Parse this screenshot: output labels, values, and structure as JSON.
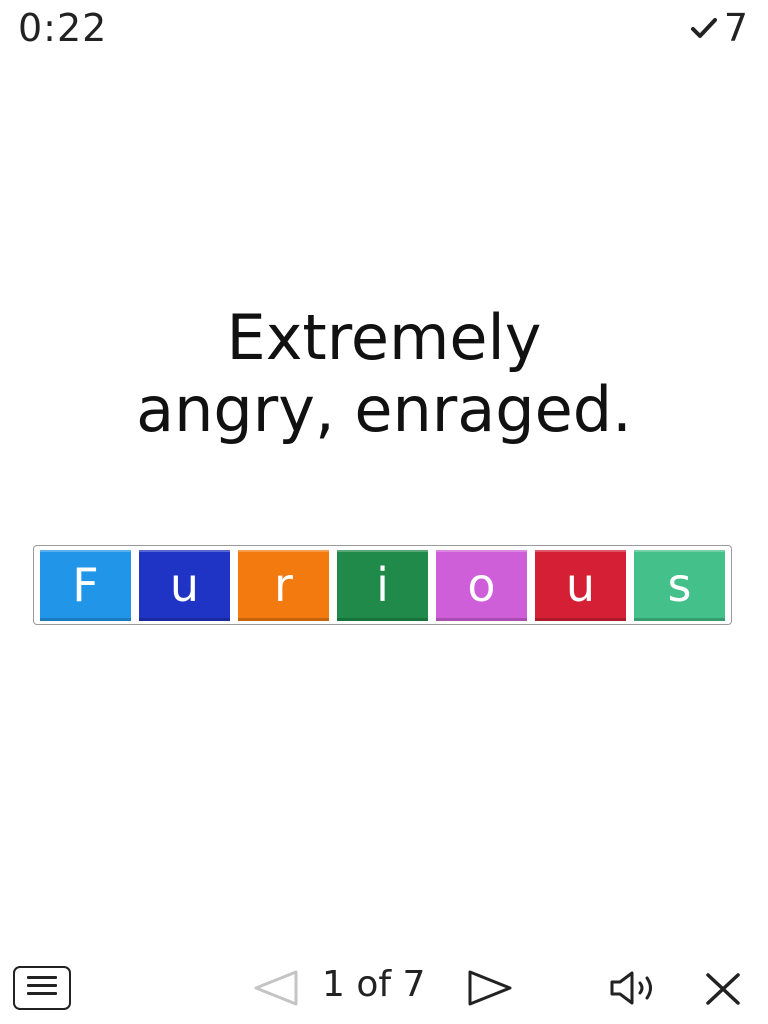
{
  "header": {
    "timer": "0:22",
    "score": "7",
    "score_icon": "checkmark-icon"
  },
  "clue": {
    "line1": "Extremely",
    "line2": "angry, enraged."
  },
  "answer": {
    "letters": [
      {
        "char": "F",
        "color": "#2196e8"
      },
      {
        "char": "u",
        "color": "#1f34c4"
      },
      {
        "char": "r",
        "color": "#f27a0f"
      },
      {
        "char": "i",
        "color": "#1f8a4a"
      },
      {
        "char": "o",
        "color": "#cf5fd8"
      },
      {
        "char": "u",
        "color": "#d51f34"
      },
      {
        "char": "s",
        "color": "#44c08a"
      }
    ]
  },
  "footer": {
    "menu_icon": "menu-icon",
    "prev_icon": "triangle-left-icon",
    "page_indicator": "1 of 7",
    "next_icon": "triangle-right-icon",
    "sound_icon": "speaker-icon",
    "close_icon": "close-icon"
  }
}
